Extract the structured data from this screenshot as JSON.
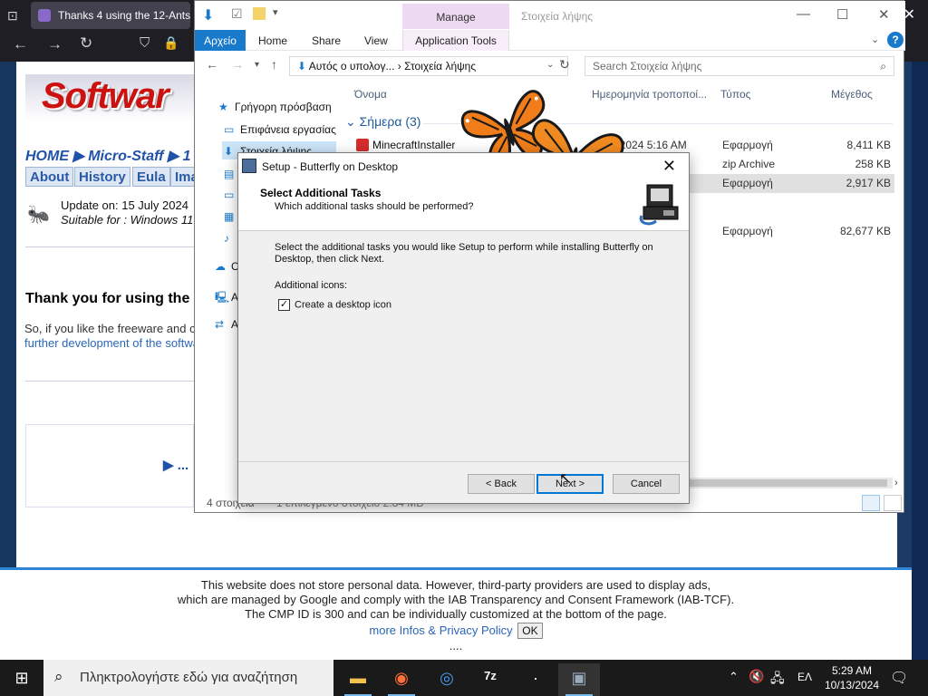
{
  "browser": {
    "tab_title": "Thanks 4 using the 12-Ants",
    "close_glyph": "✕"
  },
  "website": {
    "logo_text": "Softwar",
    "breadcrumb": "HOME ▶ Micro-Staff ▶ 1",
    "nav_buttons": [
      "About",
      "History",
      "Eula",
      "Ima"
    ],
    "update_line": "Update on:  15 July 2024",
    "suitable_line": "Suitable for : Windows 11",
    "thank_heading": "Thank you for using the I",
    "so_if_text": "So, if you like the freeware and c",
    "further_text": "further development of the softwa",
    "promo_arrow": "▶ ..."
  },
  "consent": {
    "line1": "This website does not store personal data. However, third-party providers are used to display ads,",
    "line2": "which are managed by Google and comply with the IAB Transparency and Consent Framework (IAB-TCF).",
    "line3": "The CMP ID is 300 and can be individually customized at the bottom of the page.",
    "link": "more Infos & Privacy Policy",
    "ok_label": "OK",
    "ellipsis": "...."
  },
  "explorer": {
    "manage_label": "Manage",
    "window_title": "Στοιχεία λήψης",
    "ribbon_tabs": [
      "Αρχείο",
      "Home",
      "Share",
      "View",
      "Application Tools"
    ],
    "address_path": "Αυτός ο υπολογ...  ›  Στοιχεία λήψης",
    "search_placeholder": "Search Στοιχεία λήψης",
    "nav_items": [
      "Γρήγορη πρόσβαση",
      "Επιφάνεια εργασίας",
      "Στοιχεία λήψης",
      "C",
      "A",
      "A"
    ],
    "columns": [
      "Όνομα",
      "Ημερομηνία τροποποί...",
      "Τύπος",
      "Μέγεθος"
    ],
    "group_label": "Σήμερα (3)",
    "rows": [
      {
        "name": "MinecraftInstaller",
        "date": "13/2024 5:16 AM",
        "type": "Εφαρμογή",
        "size": "8,411 KB"
      },
      {
        "name": "",
        "date": "",
        "type": "zip Archive",
        "size": "258 KB"
      },
      {
        "name": "",
        "date": "",
        "type": "Εφαρμογή",
        "size": "2,917 KB"
      },
      {
        "name": "",
        "date": "",
        "type": "Εφαρμογή",
        "size": "82,677 KB"
      }
    ],
    "status_count": "4 στοιχεία",
    "status_selected": "1 επιλεγμένο στοιχείο 2.84 MB"
  },
  "setup": {
    "title": "Setup - Butterfly on Desktop",
    "heading": "Select Additional Tasks",
    "subheading": "Which additional tasks should be performed?",
    "body": "Select the additional tasks you would like Setup to perform while installing Butterfly on Desktop, then click Next.",
    "additional_icons_label": "Additional icons:",
    "checkbox_label": "Create a desktop icon",
    "checkbox_checked": true,
    "back_label": "< Back",
    "next_label": "Next >",
    "cancel_label": "Cancel"
  },
  "taskbar": {
    "search_placeholder": "Πληκτρολογήστε εδώ για αναζήτηση",
    "language": "ΕΛ",
    "time": "5:29 AM",
    "date": "10/13/2024"
  },
  "colors": {
    "accent": "#1979ca",
    "setup_default_button": "#0078d7",
    "consent_border": "#2f86d6",
    "logo_red": "#cc1111"
  }
}
